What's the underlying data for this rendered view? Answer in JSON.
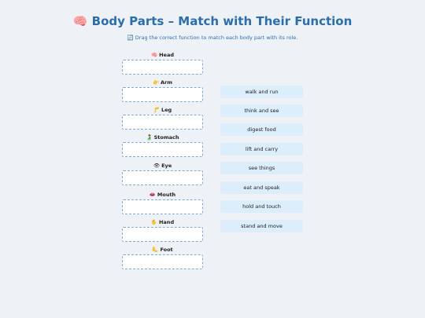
{
  "title": {
    "icon": "🧠",
    "text": "Body Parts – Match with Their Function"
  },
  "subtitle": {
    "icon": "🔄",
    "text": "Drag the correct function to match each body part with its role."
  },
  "body_parts": [
    {
      "icon": "🧠",
      "label": "Head"
    },
    {
      "icon": "👉",
      "label": "Arm"
    },
    {
      "icon": "🦵",
      "label": "Leg"
    },
    {
      "icon": "🫃",
      "label": "Stomach"
    },
    {
      "icon": "👁",
      "label": "Eye"
    },
    {
      "icon": "👄",
      "label": "Mouth"
    },
    {
      "icon": "✋",
      "label": "Hand"
    },
    {
      "icon": "🦶",
      "label": "Foot"
    }
  ],
  "functions": [
    "walk and run",
    "think and see",
    "digest food",
    "lift and carry",
    "see things",
    "eat and speak",
    "hold and touch",
    "stand and move"
  ]
}
